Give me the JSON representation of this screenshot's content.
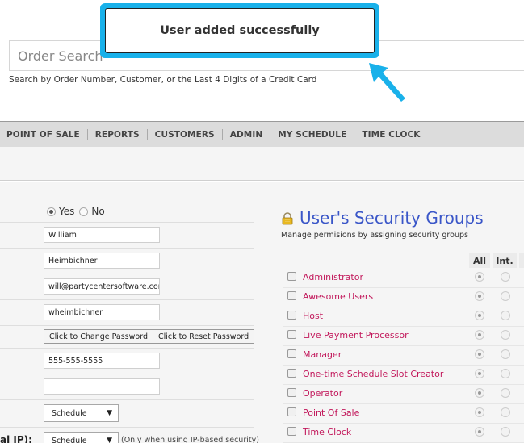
{
  "toast": {
    "message": "User added successfully",
    "accent_color": "#19b1ea"
  },
  "search": {
    "placeholder": "Order Search",
    "hint": "Search by Order Number, Customer, or the Last 4 Digits of a Credit Card"
  },
  "nav": {
    "items": [
      {
        "label": "POINT OF SALE"
      },
      {
        "label": "REPORTS"
      },
      {
        "label": "CUSTOMERS"
      },
      {
        "label": "ADMIN"
      },
      {
        "label": "MY SCHEDULE"
      },
      {
        "label": "TIME CLOCK"
      }
    ]
  },
  "form": {
    "active": {
      "yes_label": "Yes",
      "no_label": "No",
      "selected": "Yes"
    },
    "first_name": "William",
    "last_name": "Heimbichner",
    "email": "will@partycentersoftware.com",
    "username": "wheimbichner",
    "change_password_label": "Click to Change Password",
    "reset_password_label": "Click to Reset Password",
    "phone": "555-555-5555",
    "blank_field": "",
    "default_page": "Schedule",
    "default_page_ip": "Schedule",
    "ip_row_label_fragment": "al IP):",
    "ip_note": "(Only when using IP-based security)"
  },
  "security_groups": {
    "title": "User's Security Groups",
    "subtitle": "Manage permisions by assigning security groups",
    "columns": [
      "All",
      "Int."
    ],
    "groups": [
      {
        "name": "Administrator",
        "checked": false,
        "scope": "All"
      },
      {
        "name": "Awesome Users",
        "checked": false,
        "scope": "All"
      },
      {
        "name": "Host",
        "checked": false,
        "scope": "All"
      },
      {
        "name": "Live Payment Processor",
        "checked": false,
        "scope": "All"
      },
      {
        "name": "Manager",
        "checked": false,
        "scope": "All"
      },
      {
        "name": "One-time Schedule Slot Creator",
        "checked": false,
        "scope": "All"
      },
      {
        "name": "Operator",
        "checked": false,
        "scope": "All"
      },
      {
        "name": "Point Of Sale",
        "checked": false,
        "scope": "All"
      },
      {
        "name": "Time Clock",
        "checked": false,
        "scope": "All"
      }
    ]
  }
}
